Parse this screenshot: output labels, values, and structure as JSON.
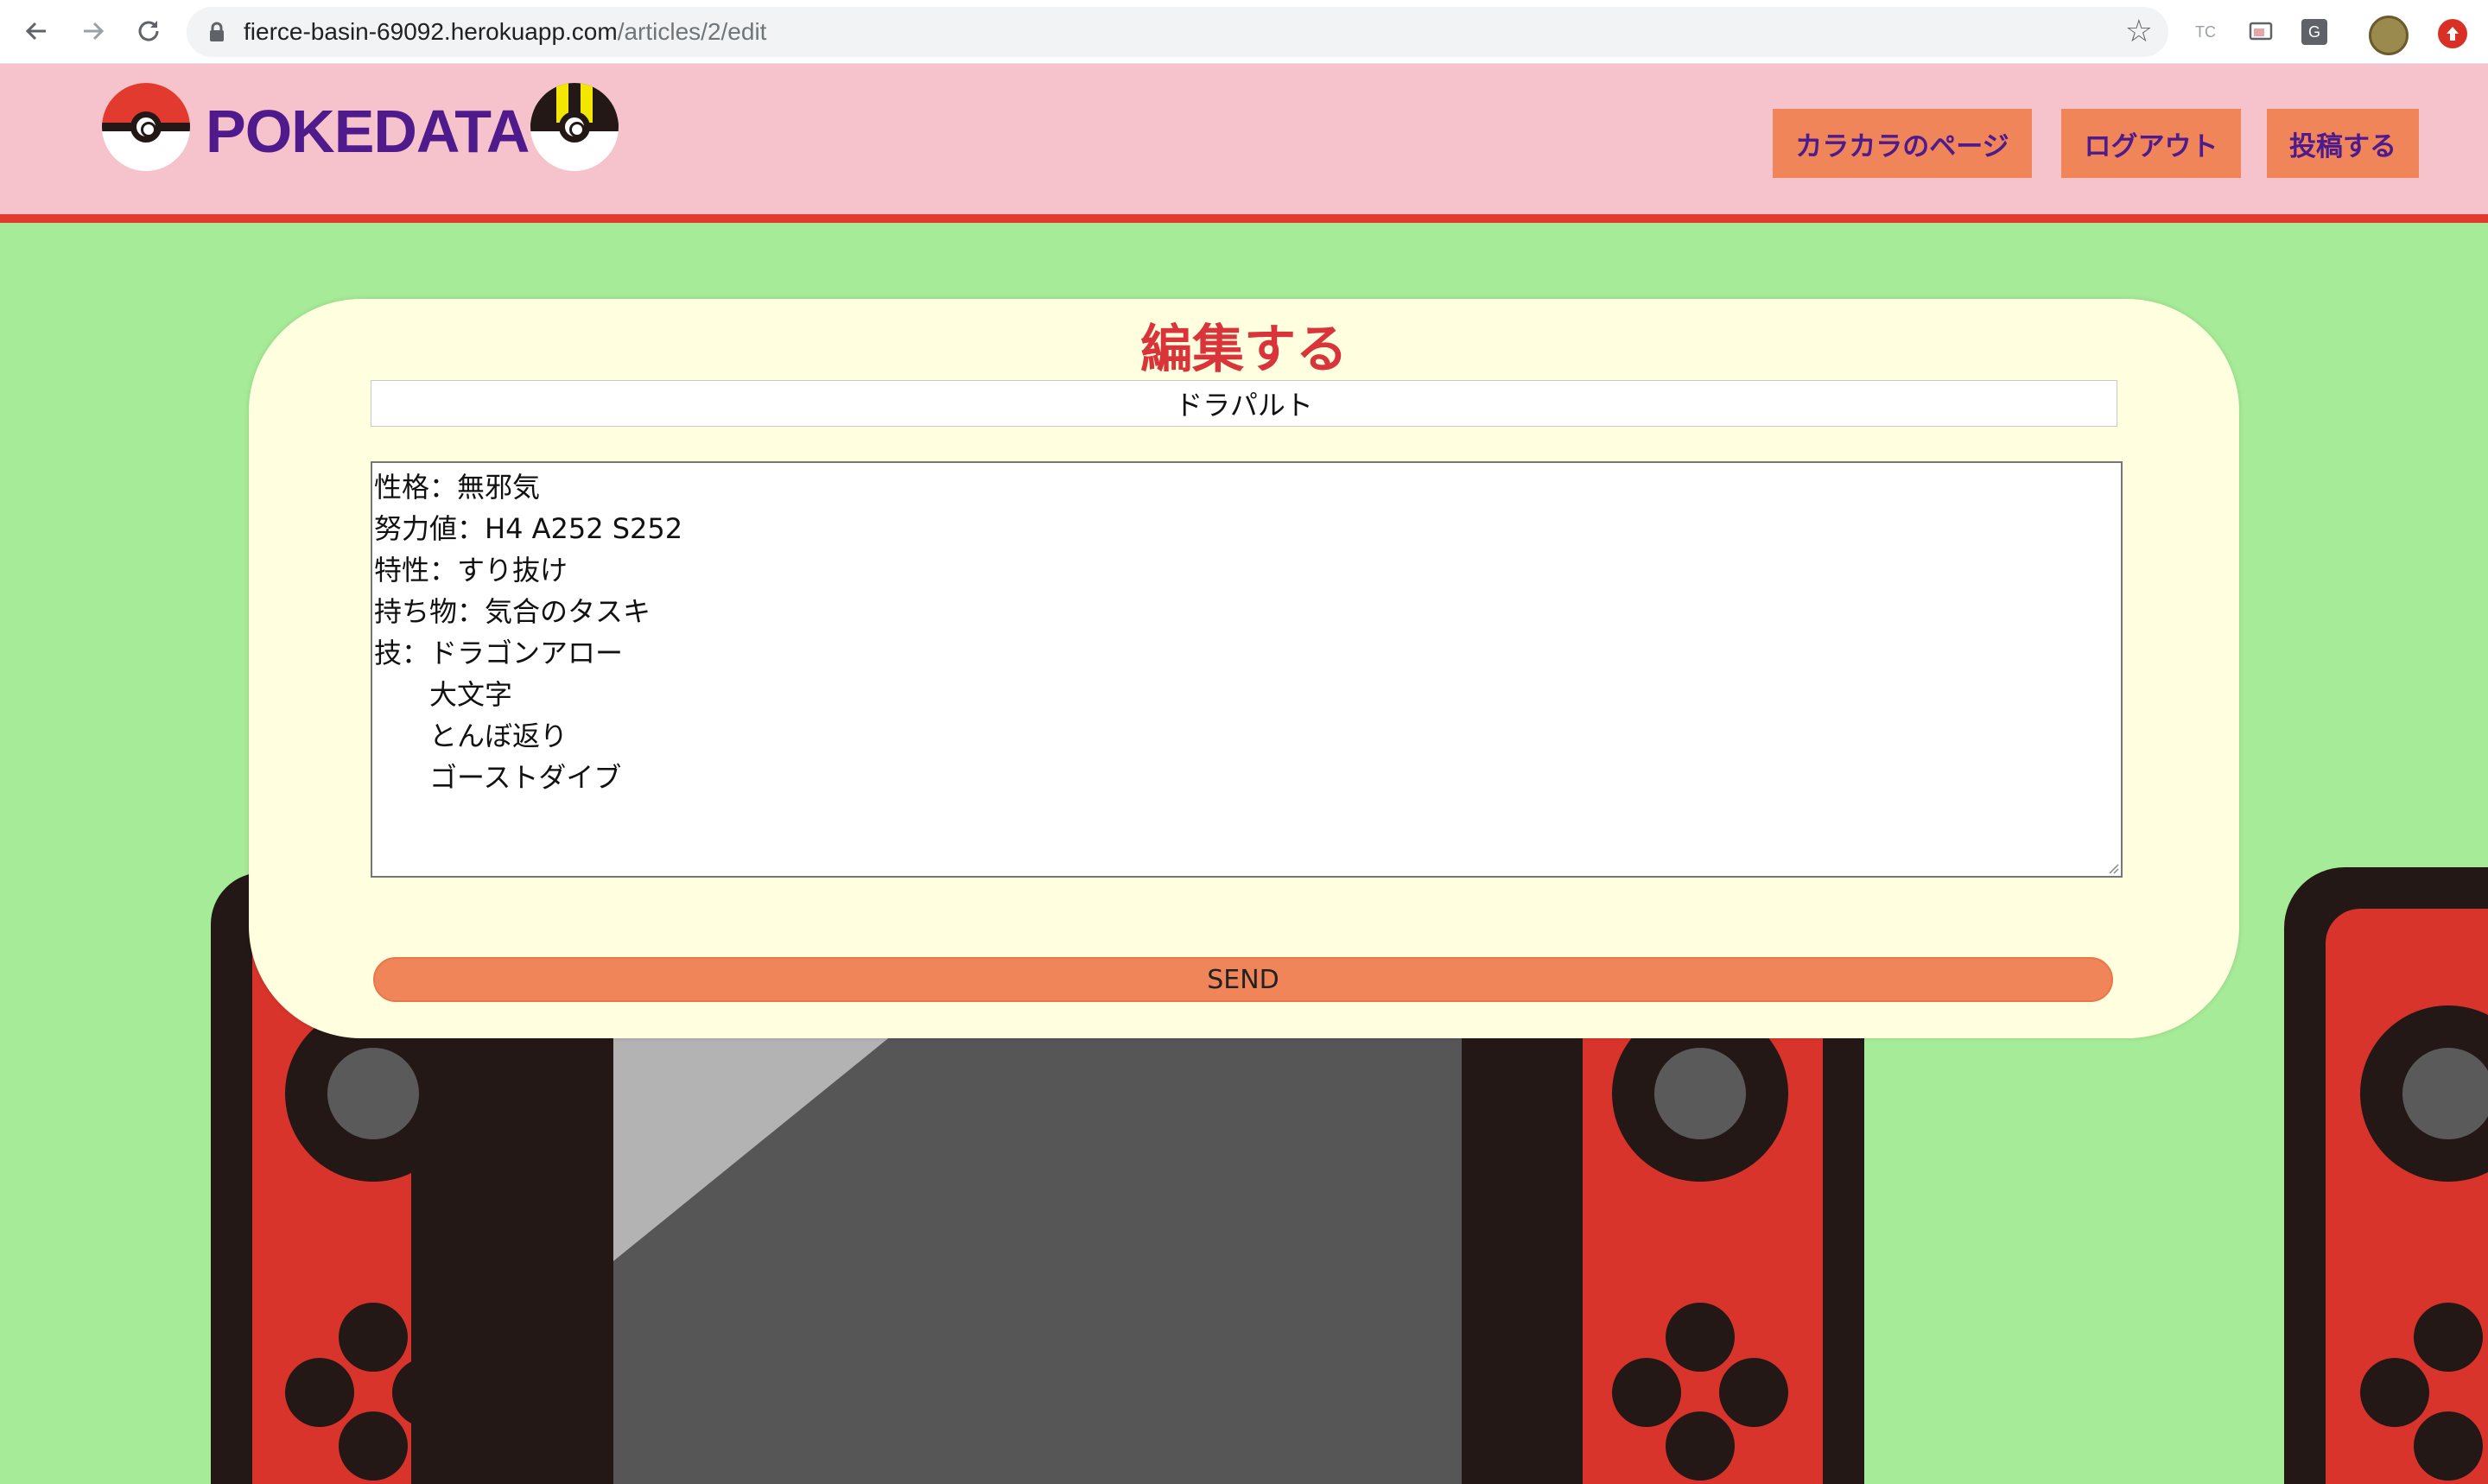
{
  "browser": {
    "url_host": "fierce-basin-69092.herokuapp.com",
    "url_path": "/articles/2/edit",
    "back_icon": "arrow-left-icon",
    "forward_icon": "arrow-right-icon",
    "reload_icon": "reload-icon",
    "extensions": [
      "TC",
      "G"
    ]
  },
  "header": {
    "logo_text": "POKEDATA",
    "nav": {
      "mypage_label": "カラカラのページ",
      "logout_label": "ログアウト",
      "post_label": "投稿する"
    }
  },
  "form": {
    "heading": "編集する",
    "title_value": "ドラパルト",
    "body_lines": [
      "性格：無邪気",
      "努力値：H4 A252 S252",
      "特性：すり抜け",
      "持ち物：気合のタスキ",
      "技：ドラゴンアロー",
      "　　大文字",
      "　　とんぼ返り",
      "　　ゴーストダイブ"
    ],
    "submit_label": "SEND"
  },
  "colors": {
    "page_bg": "#a6eb97",
    "header_bg": "#f6c3cc",
    "header_border": "#e33a2f",
    "accent": "#ef8559",
    "brand_purple": "#4e1a8c",
    "heading_red": "#d9343a",
    "card_bg": "#fffedf"
  }
}
